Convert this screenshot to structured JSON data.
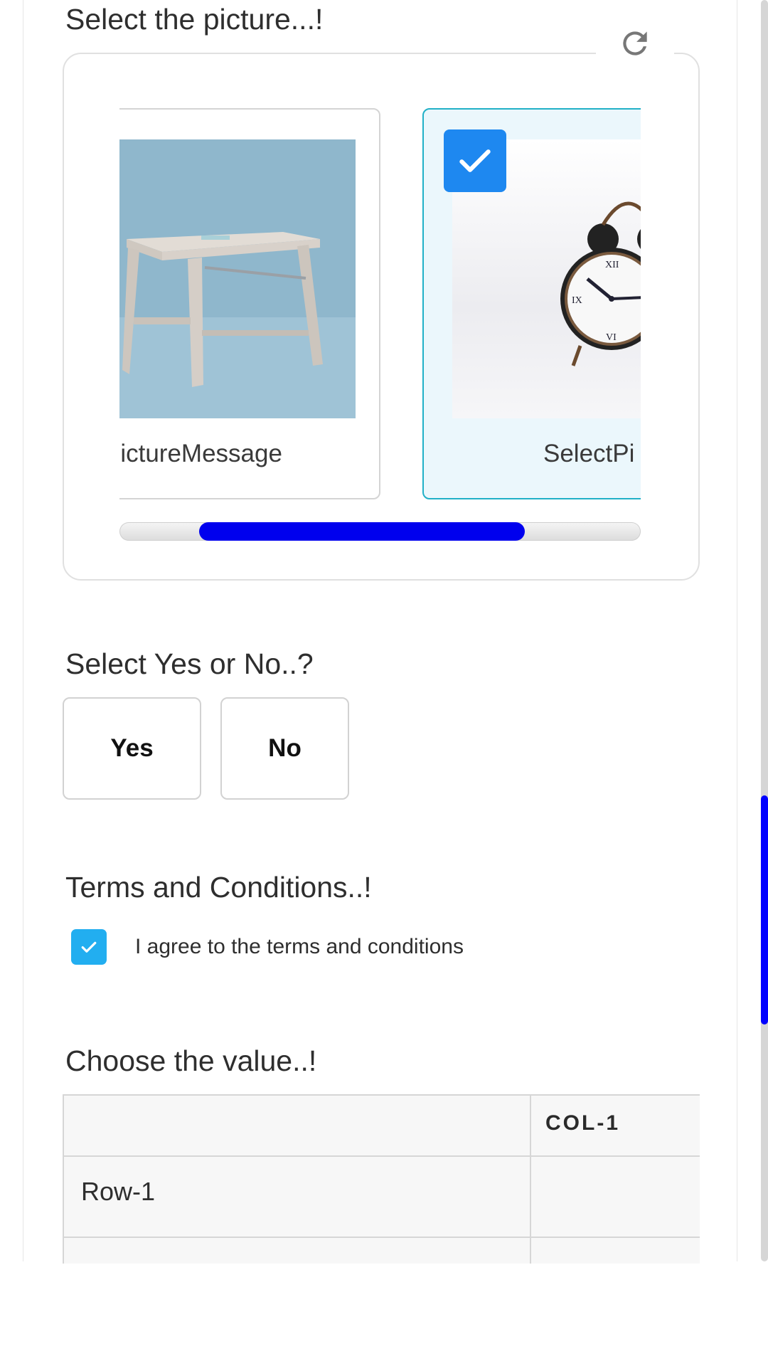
{
  "colors": {
    "accent": "#1e88f0",
    "selected_bg": "#ebf7fc",
    "selected_border": "#21b0c7",
    "scroll_thumb": "#0000ff",
    "checkbox": "#22aef0"
  },
  "picture_question": {
    "title": "Select the picture...!",
    "refresh_icon": "refresh-icon",
    "options": [
      {
        "caption": "PictureMessage",
        "image": "wooden-stool",
        "selected": false
      },
      {
        "caption": "SelectPi",
        "image": "alarm-clock",
        "selected": true
      }
    ],
    "carousel_progress": 0.5
  },
  "yes_no_question": {
    "title": "Select Yes or No..?",
    "yes_label": "Yes",
    "no_label": "No"
  },
  "terms": {
    "title": "Terms and Conditions..!",
    "checkbox_label": "I agree to the terms and conditions",
    "checked": true
  },
  "matrix_question": {
    "title": "Choose the value..!",
    "columns": [
      "COL-1"
    ],
    "rows": [
      "Row-1"
    ]
  }
}
